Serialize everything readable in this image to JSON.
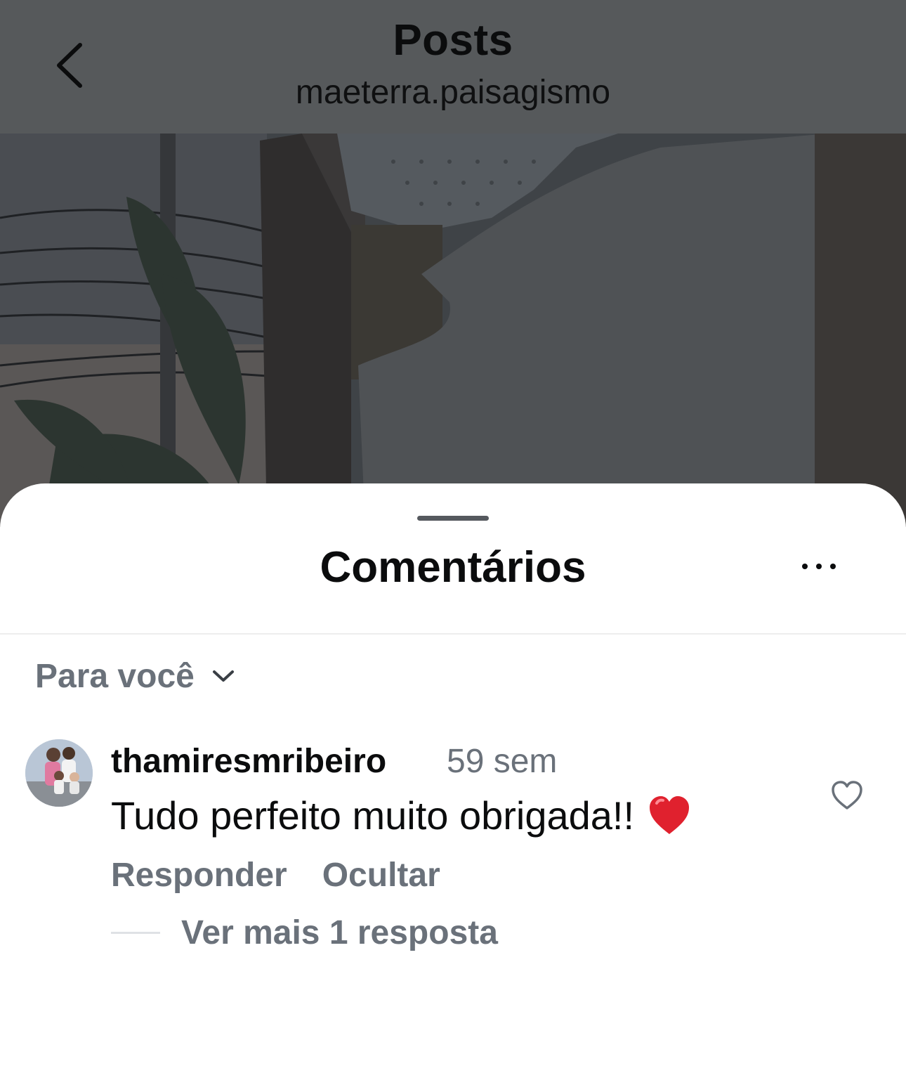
{
  "header": {
    "title": "Posts",
    "subtitle": "maeterra.paisagismo"
  },
  "sheet": {
    "title": "Comentários"
  },
  "filter": {
    "label": "Para você"
  },
  "comments": [
    {
      "username": "thamiresmribeiro",
      "time": "59 sem",
      "text": "Tudo perfeito muito obrigada!!",
      "emoji": "heart-emoji",
      "actions": [
        "Responder",
        "Ocultar"
      ],
      "replies_label": "Ver mais 1 resposta"
    }
  ],
  "colors": {
    "overlay": "#56595b",
    "text_primary": "#0b0c0d",
    "text_secondary": "#6a717a",
    "emoji_red": "#e0212e"
  }
}
